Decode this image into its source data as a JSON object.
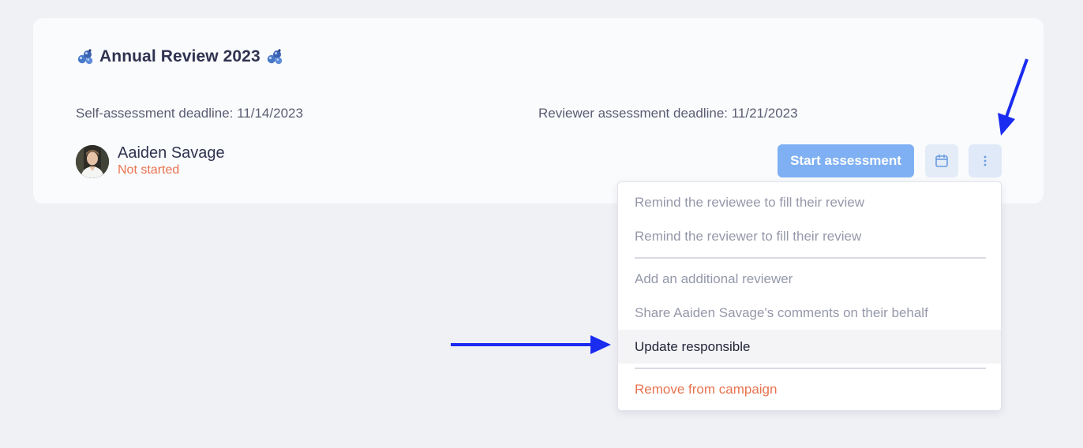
{
  "campaign": {
    "title": "Annual Review 2023",
    "title_icon": "molecule-emoji-icon",
    "self_deadline": "Self-assessment deadline: 11/14/2023",
    "reviewer_deadline": "Reviewer assessment deadline: 11/21/2023"
  },
  "reviewee": {
    "name": "Aaiden Savage",
    "status": "Not started",
    "status_color": "#e8734f"
  },
  "actions": {
    "start_label": "Start assessment",
    "start_color": "#7fb0f3",
    "calendar_icon": "calendar-icon",
    "more_icon": "more-vertical-icon"
  },
  "menu": {
    "items": [
      {
        "label": "Remind the reviewee to fill their review",
        "state": "normal"
      },
      {
        "label": "Remind the reviewer to fill their review",
        "state": "normal"
      },
      {
        "label": "Add an additional reviewer",
        "state": "normal"
      },
      {
        "label": "Share Aaiden Savage's comments on their behalf",
        "state": "normal"
      },
      {
        "label": "Update responsible",
        "state": "highlighted"
      },
      {
        "label": "Remove from campaign",
        "state": "danger"
      }
    ],
    "danger_color": "#e8734f"
  },
  "annotations": {
    "arrow_color": "#1a2cf0",
    "arrows": [
      "arrow-to-more-button",
      "arrow-to-update-responsible"
    ]
  }
}
